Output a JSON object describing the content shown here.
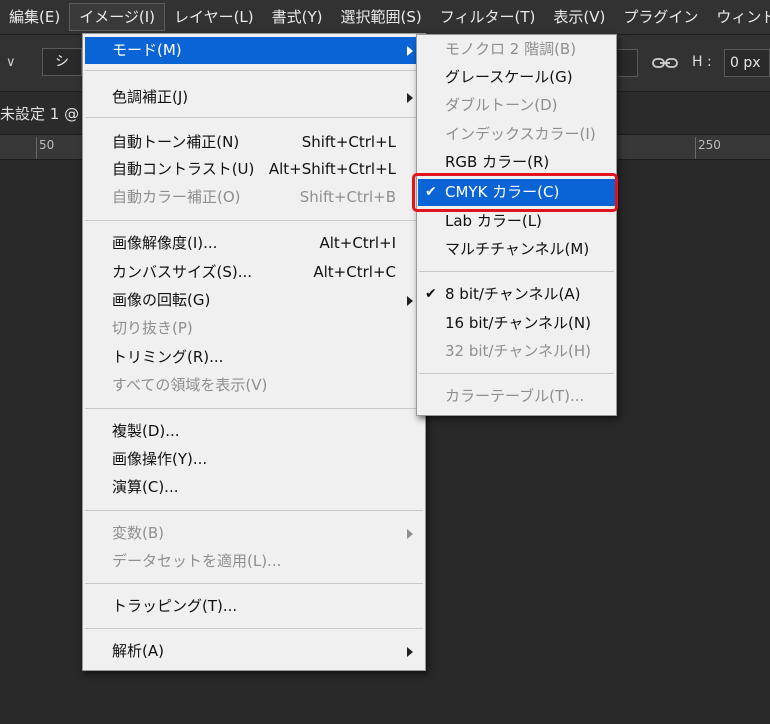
{
  "menubar": {
    "items": [
      "編集(E)",
      "イメージ(I)",
      "レイヤー(L)",
      "書式(Y)",
      "選択範囲(S)",
      "フィルター(T)",
      "表示(V)",
      "プラグイン",
      "ウィンドウ"
    ]
  },
  "options_bar": {
    "tool_text": "シェ",
    "h_label": "H :",
    "h_value": "0 px"
  },
  "document": {
    "tab_title": "未設定 1 @",
    "ruler_labels": [
      "50",
      "250"
    ]
  },
  "image_menu": {
    "items": [
      {
        "label": "モード(M)",
        "shortcut": "",
        "submenu": true,
        "disabled": false,
        "highlighted": true
      },
      {
        "label": "色調補正(J)",
        "shortcut": "",
        "submenu": true,
        "disabled": false
      },
      {
        "label": "自動トーン補正(N)",
        "shortcut": "Shift+Ctrl+L",
        "disabled": false
      },
      {
        "label": "自動コントラスト(U)",
        "shortcut": "Alt+Shift+Ctrl+L",
        "disabled": false
      },
      {
        "label": "自動カラー補正(O)",
        "shortcut": "Shift+Ctrl+B",
        "disabled": true
      },
      {
        "label": "画像解像度(I)...",
        "shortcut": "Alt+Ctrl+I",
        "disabled": false
      },
      {
        "label": "カンバスサイズ(S)...",
        "shortcut": "Alt+Ctrl+C",
        "disabled": false
      },
      {
        "label": "画像の回転(G)",
        "shortcut": "",
        "submenu": true,
        "disabled": false
      },
      {
        "label": "切り抜き(P)",
        "shortcut": "",
        "disabled": true
      },
      {
        "label": "トリミング(R)...",
        "shortcut": "",
        "disabled": false
      },
      {
        "label": "すべての領域を表示(V)",
        "shortcut": "",
        "disabled": true
      },
      {
        "label": "複製(D)...",
        "shortcut": "",
        "disabled": false
      },
      {
        "label": "画像操作(Y)...",
        "shortcut": "",
        "disabled": false
      },
      {
        "label": "演算(C)...",
        "shortcut": "",
        "disabled": false
      },
      {
        "label": "変数(B)",
        "shortcut": "",
        "submenu": true,
        "disabled": true
      },
      {
        "label": "データセットを適用(L)...",
        "shortcut": "",
        "disabled": true
      },
      {
        "label": "トラッピング(T)...",
        "shortcut": "",
        "disabled": false
      },
      {
        "label": "解析(A)",
        "shortcut": "",
        "submenu": true,
        "disabled": false
      }
    ]
  },
  "mode_menu": {
    "items": [
      {
        "label": "モノクロ 2 階調(B)",
        "disabled": true,
        "checked": false
      },
      {
        "label": "グレースケール(G)",
        "disabled": false,
        "checked": false
      },
      {
        "label": "ダブルトーン(D)",
        "disabled": true,
        "checked": false
      },
      {
        "label": "インデックスカラー(I)",
        "disabled": true,
        "checked": false
      },
      {
        "label": "RGB カラー(R)",
        "disabled": false,
        "checked": false
      },
      {
        "label": "CMYK カラー(C)",
        "disabled": false,
        "checked": true,
        "highlighted": true
      },
      {
        "label": "Lab カラー(L)",
        "disabled": false,
        "checked": false
      },
      {
        "label": "マルチチャンネル(M)",
        "disabled": false,
        "checked": false
      },
      {
        "label": "8 bit/チャンネル(A)",
        "disabled": false,
        "checked": true
      },
      {
        "label": "16 bit/チャンネル(N)",
        "disabled": false,
        "checked": false
      },
      {
        "label": "32 bit/チャンネル(H)",
        "disabled": true,
        "checked": false
      },
      {
        "label": "カラーテーブル(T)...",
        "disabled": true,
        "checked": false
      }
    ],
    "check_glyph": "✔"
  },
  "colors": {
    "highlight": "#0a64d6",
    "callout": "#e0141e",
    "app_bg": "#282828"
  }
}
